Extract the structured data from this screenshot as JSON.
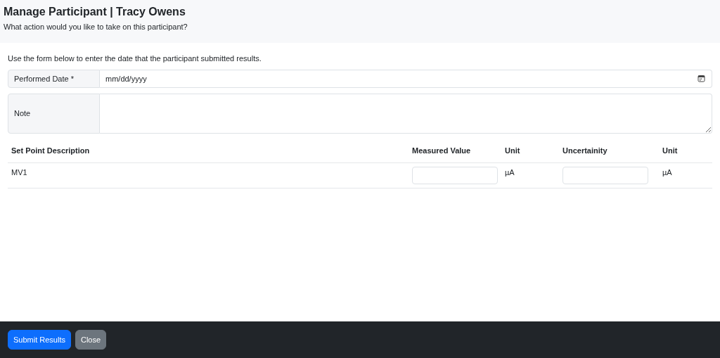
{
  "header": {
    "title": "Manage Participant | Tracy Owens",
    "subtitle": "What action would you like to take on this participant?"
  },
  "instructions": "Use the form below to enter the date that the participant submitted results.",
  "date_field": {
    "label": "Performed Date *",
    "placeholder": "mm/dd/yyyy"
  },
  "note_field": {
    "label": "Note"
  },
  "table": {
    "columns": [
      "Set Point Description",
      "Measured Value",
      "Unit",
      "Uncertainity",
      "Unit"
    ],
    "rows": [
      {
        "description": "MV1",
        "measured_unit": "µA",
        "uncertainty_unit": "µA"
      }
    ]
  },
  "buttons": [
    {
      "label": "Submit Results",
      "kind": "primary"
    },
    {
      "label": "Close",
      "kind": "secondary"
    }
  ]
}
